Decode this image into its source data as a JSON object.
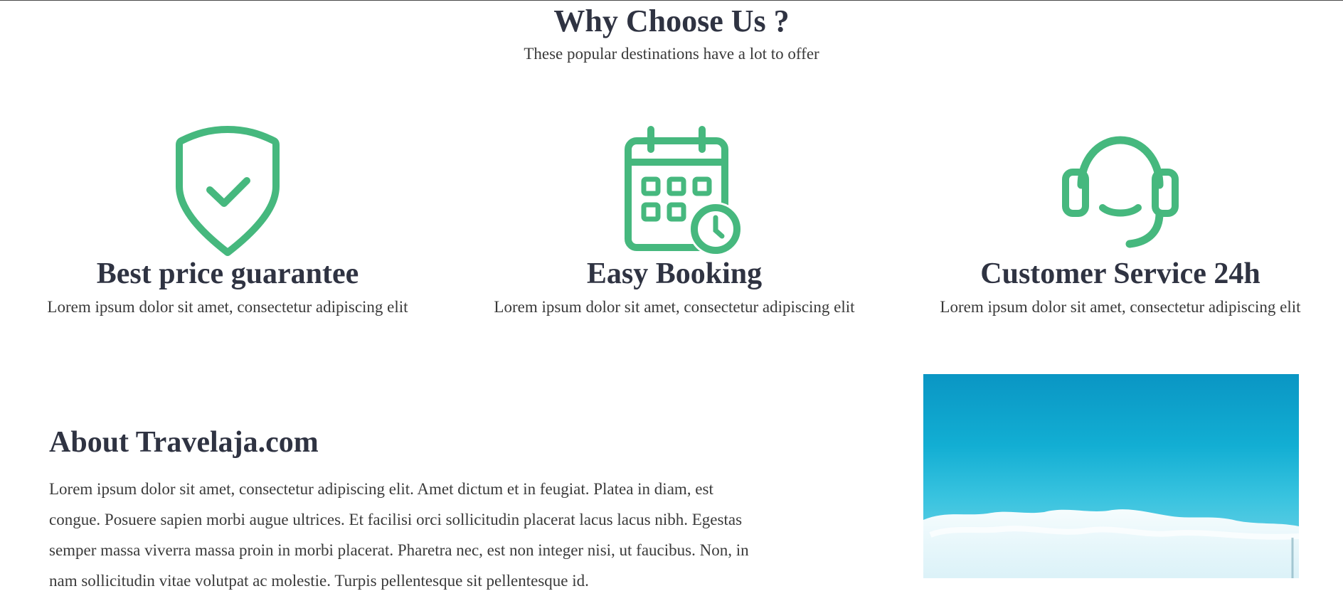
{
  "why_section": {
    "title": "Why Choose Us ?",
    "subtitle": "These popular destinations have a lot to offer"
  },
  "features": [
    {
      "icon": "shield-check-icon",
      "title": "Best price guarantee",
      "description": "Lorem ipsum dolor sit amet, consectetur adipiscing elit"
    },
    {
      "icon": "calendar-clock-icon",
      "title": "Easy Booking",
      "description": "Lorem ipsum dolor sit amet, consectetur adipiscing elit"
    },
    {
      "icon": "headset-icon",
      "title": "Customer Service 24h",
      "description": "Lorem ipsum dolor sit amet, consectetur adipiscing elit"
    }
  ],
  "about": {
    "title": "About Travelaja.com",
    "body": "Lorem ipsum dolor sit amet, consectetur adipiscing elit. Amet dictum et in feugiat. Platea in diam, est congue. Posuere sapien morbi augue ultrices. Et facilisi orci sollicitudin placerat lacus lacus nibh. Egestas semper massa viverra massa proin in morbi placerat. Pharetra nec, est non integer nisi, ut faucibus. Non, in nam sollicitudin vitae volutpat ac molestie. Turpis pellentesque sit pellentesque id."
  },
  "colors": {
    "accent": "#46b87e",
    "heading": "#2f3342",
    "body_text": "#3a3a3a"
  }
}
